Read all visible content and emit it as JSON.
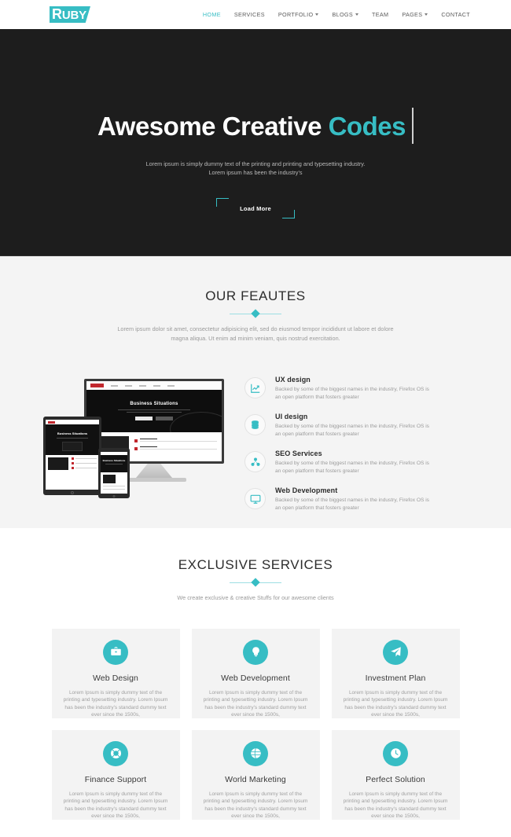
{
  "brand": {
    "logo_text_initial": "R",
    "logo_text_rest": "UBY",
    "accent_color": "#37bdc4",
    "dark_color": "#1d1d1d"
  },
  "nav": {
    "items": [
      {
        "label": "HOME",
        "has_caret": false,
        "active": true
      },
      {
        "label": "SERVICES",
        "has_caret": false,
        "active": false
      },
      {
        "label": "PORTFOLIO",
        "has_caret": true,
        "active": false
      },
      {
        "label": "BLOGS",
        "has_caret": true,
        "active": false
      },
      {
        "label": "TEAM",
        "has_caret": false,
        "active": false
      },
      {
        "label": "PAGES",
        "has_caret": true,
        "active": false
      },
      {
        "label": "CONTACT",
        "has_caret": false,
        "active": false
      }
    ]
  },
  "hero": {
    "title_main": "Awesome Creative ",
    "title_accent": "Codes",
    "subtitle_line1": "Lorem ipsum is simply dummy text of the printing and printing and typesetting industry.",
    "subtitle_line2": "Lorem ipsum has been the industry's",
    "button_label": "Load More"
  },
  "features": {
    "title": "OUR FEAUTES",
    "subtitle": "Lorem ipsum dolor sit amet, consectetur adipisicing elit, sed do eiusmod tempor incididunt ut labore et dolore magna aliqua. Ut enim ad minim veniam, quis nostrud exercitation.",
    "mockup": {
      "site_title": "Business Situations",
      "alt": "responsive device mockup showing desktop monitor, tablet and smartphone"
    },
    "items": [
      {
        "icon": "growth-chart-icon",
        "title": "UX design",
        "desc": "Backed by some of the biggest names in the industry, Firefox OS is an open platform that fosters greater"
      },
      {
        "icon": "database-stack-icon",
        "title": "UI design",
        "desc": "Backed by some of the biggest names in the industry, Firefox OS is an open platform that fosters greater"
      },
      {
        "icon": "network-nodes-icon",
        "title": "SEO Services",
        "desc": "Backed by some of the biggest names in the industry, Firefox OS is an open platform that fosters greater"
      },
      {
        "icon": "monitor-icon",
        "title": "Web Development",
        "desc": "Backed by some of the biggest names in the industry, Firefox OS is an open platform that fosters greater"
      }
    ]
  },
  "services": {
    "title": "EXCLUSIVE SERVICES",
    "subtitle": "We create exclusive & creative Stuffs for our awesome clients",
    "cards": [
      {
        "icon": "briefcase-icon",
        "title": "Web Design",
        "desc": "Lorem Ipsum is simply dummy text of the printing and typesetting industry. Lorem Ipsum has been the industry's standard dummy text ever since the 1500s,"
      },
      {
        "icon": "lightbulb-icon",
        "title": "Web Development",
        "desc": "Lorem Ipsum is simply dummy text of the printing and typesetting industry. Lorem Ipsum has been the industry's standard dummy text ever since the 1500s,"
      },
      {
        "icon": "paper-plane-icon",
        "title": "Investment Plan",
        "desc": "Lorem Ipsum is simply dummy text of the printing and typesetting industry. Lorem Ipsum has been the industry's standard dummy text ever since the 1500s,"
      },
      {
        "icon": "life-ring-icon",
        "title": "Finance Support",
        "desc": "Lorem Ipsum is simply dummy text of the printing and typesetting industry. Lorem Ipsum has been the industry's standard dummy text ever since the 1500s,"
      },
      {
        "icon": "globe-icon",
        "title": "World Marketing",
        "desc": "Lorem Ipsum is simply dummy text of the printing and typesetting industry. Lorem Ipsum has been the industry's standard dummy text ever since the 1500s,"
      },
      {
        "icon": "clock-icon",
        "title": "Perfect Solution",
        "desc": "Lorem Ipsum is simply dummy text of the printing and typesetting industry. Lorem Ipsum has been the industry's standard dummy text ever since the 1500s,"
      }
    ]
  }
}
